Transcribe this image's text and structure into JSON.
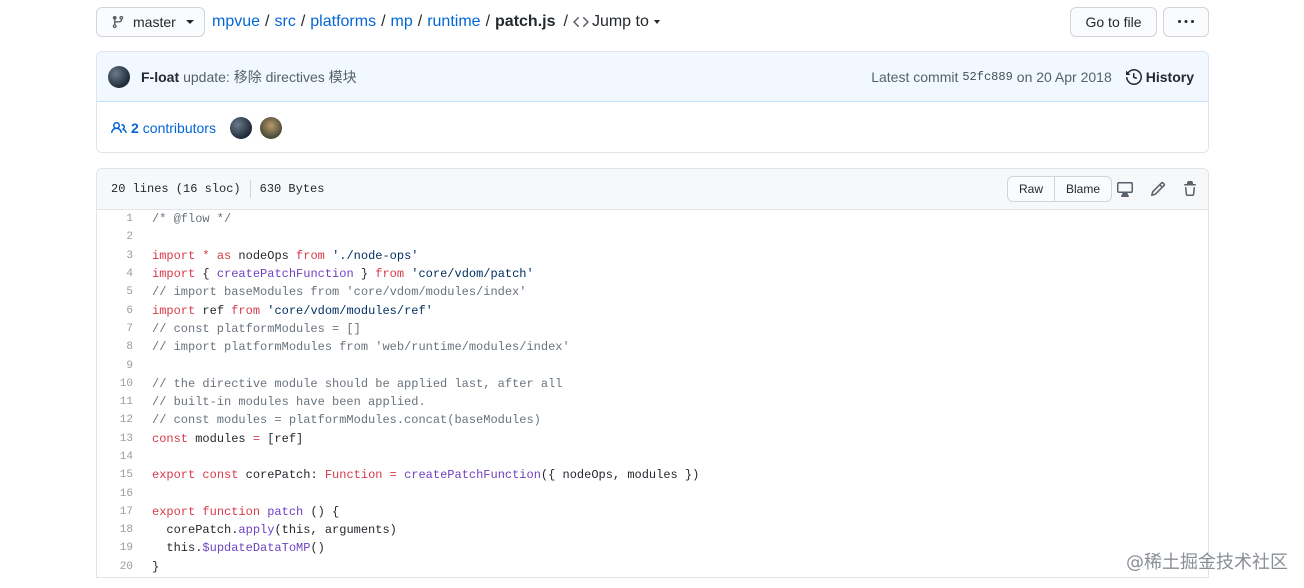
{
  "header": {
    "branch": "master",
    "breadcrumb": [
      {
        "label": "mpvue"
      },
      {
        "label": "src"
      },
      {
        "label": "platforms"
      },
      {
        "label": "mp"
      },
      {
        "label": "runtime"
      }
    ],
    "file_name": "patch.js",
    "jump_to": "Jump to",
    "go_to_file": "Go to file"
  },
  "commit": {
    "author": "F-loat",
    "message": "update: 移除 directives 模块",
    "latest_commit_label": "Latest commit",
    "sha": "52fc889",
    "date": "on 20 Apr 2018",
    "history_label": "History"
  },
  "contributors": {
    "count": "2",
    "label": "contributors"
  },
  "file": {
    "lines_info": "20 lines (16 sloc)",
    "size": "630 Bytes",
    "raw_label": "Raw",
    "blame_label": "Blame"
  },
  "code": {
    "lines": [
      {
        "n": "1",
        "text": "/* @flow */"
      },
      {
        "n": "2",
        "text": ""
      },
      {
        "n": "3",
        "text": "import * as nodeOps from './node-ops'"
      },
      {
        "n": "4",
        "text": "import { createPatchFunction } from 'core/vdom/patch'"
      },
      {
        "n": "5",
        "text": "// import baseModules from 'core/vdom/modules/index'"
      },
      {
        "n": "6",
        "text": "import ref from 'core/vdom/modules/ref'"
      },
      {
        "n": "7",
        "text": "// const platformModules = []"
      },
      {
        "n": "8",
        "text": "// import platformModules from 'web/runtime/modules/index'"
      },
      {
        "n": "9",
        "text": ""
      },
      {
        "n": "10",
        "text": "// the directive module should be applied last, after all"
      },
      {
        "n": "11",
        "text": "// built-in modules have been applied."
      },
      {
        "n": "12",
        "text": "// const modules = platformModules.concat(baseModules)"
      },
      {
        "n": "13",
        "text": "const modules = [ref]"
      },
      {
        "n": "14",
        "text": ""
      },
      {
        "n": "15",
        "text": "export const corePatch: Function = createPatchFunction({ nodeOps, modules })"
      },
      {
        "n": "16",
        "text": ""
      },
      {
        "n": "17",
        "text": "export function patch () {"
      },
      {
        "n": "18",
        "text": "  corePatch.apply(this, arguments)"
      },
      {
        "n": "19",
        "text": "  this.$updateDataToMP()"
      },
      {
        "n": "20",
        "text": "}"
      }
    ]
  },
  "watermark": "@稀土掘金技术社区"
}
